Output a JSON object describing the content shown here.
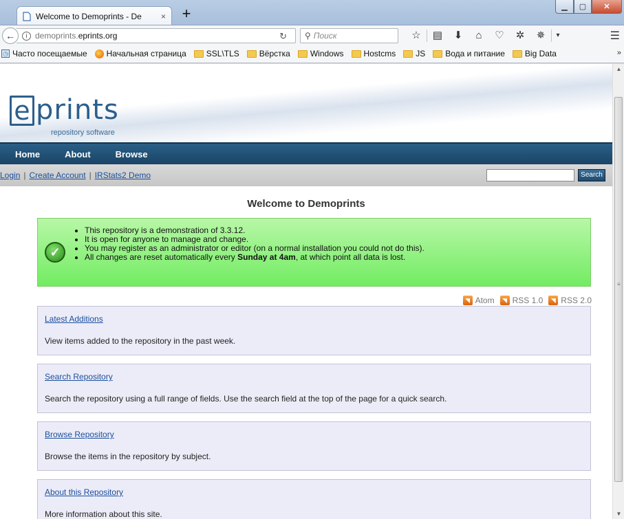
{
  "browser": {
    "tab_title": "Welcome to Demoprints - De",
    "tab_close": "×",
    "new_tab": "+",
    "url_prefix": "demoprints.",
    "url_domain": "eprints.org",
    "search_placeholder": "Поиск",
    "bookmarks": [
      {
        "label": "Часто посещаемые",
        "icon": "generic"
      },
      {
        "label": "Начальная страница",
        "icon": "firefox"
      },
      {
        "label": "SSL\\TLS",
        "icon": "folder"
      },
      {
        "label": "Вёрстка",
        "icon": "folder"
      },
      {
        "label": "Windows",
        "icon": "folder"
      },
      {
        "label": "Hostcms",
        "icon": "folder"
      },
      {
        "label": "JS",
        "icon": "folder"
      },
      {
        "label": "Вода и питание",
        "icon": "folder"
      },
      {
        "label": "Big Data",
        "icon": "folder"
      }
    ],
    "bookmarks_more": "»"
  },
  "site": {
    "logo_e": "e",
    "logo_rest": "prints",
    "tagline": "repository software",
    "menu": [
      "Home",
      "About",
      "Browse"
    ],
    "links": [
      "Login",
      "Create Account",
      "IRStats2 Demo"
    ],
    "search_button": "Search",
    "title": "Welcome to Demoprints",
    "notice_pre": [
      "This repository is a demonstration of 3.3.12.",
      "It is open for anyone to manage and change.",
      "You may register as an administrator or editor (on a normal installation you could not do this)."
    ],
    "notice_last_pre": "All changes are reset automatically every ",
    "notice_last_bold": "Sunday at 4am",
    "notice_last_post": ", at which point all data is lost.",
    "feeds": [
      "Atom",
      "RSS 1.0",
      "RSS 2.0"
    ],
    "panels": [
      {
        "title": "Latest Additions",
        "desc": "View items added to the repository in the past week."
      },
      {
        "title": "Search Repository",
        "desc": "Search the repository using a full range of fields. Use the search field at the top of the page for a quick search."
      },
      {
        "title": "Browse Repository",
        "desc": "Browse the items in the repository by subject."
      },
      {
        "title": "About this Repository",
        "desc": "More information about this site."
      }
    ]
  },
  "colors": {
    "header_blue": "#1b4466",
    "link_blue": "#1a4f9c",
    "notice_green": "#72ec62",
    "panel_bg": "#ececf8"
  }
}
